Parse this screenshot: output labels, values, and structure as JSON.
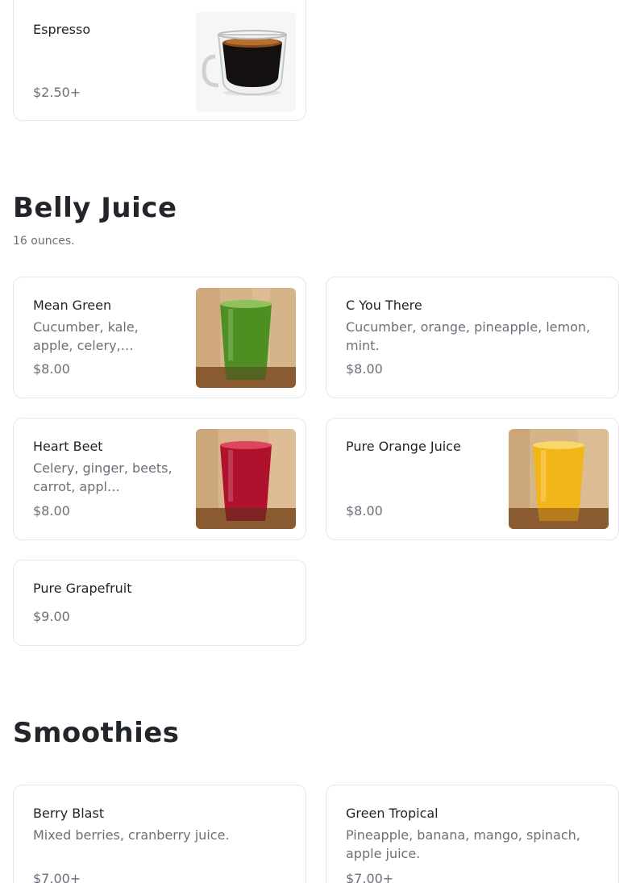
{
  "coffee": {
    "items": [
      {
        "name": "Espresso",
        "price": "$2.50+",
        "image": "espresso-cup-photo"
      }
    ]
  },
  "belly_juice": {
    "title": "Belly Juice",
    "subtitle": "16 ounces.",
    "items": [
      {
        "name": "Mean Green",
        "description": "Cucumber, kale, apple, celery,…",
        "price": "$8.00",
        "image": "green-juice-photo"
      },
      {
        "name": "C You There",
        "description": "Cucumber, orange, pineapple, lemon, mint.",
        "price": "$8.00"
      },
      {
        "name": "Heart Beet",
        "description": "Celery, ginger, beets, carrot, appl…",
        "price": "$8.00",
        "image": "beet-juice-photo"
      },
      {
        "name": "Pure Orange Juice",
        "description": "",
        "price": "$8.00",
        "image": "orange-juice-photo"
      },
      {
        "name": "Pure Grapefruit",
        "price": "$9.00"
      }
    ]
  },
  "smoothies": {
    "title": "Smoothies",
    "items": [
      {
        "name": "Berry Blast",
        "description": "Mixed berries, cranberry juice.",
        "price": "$7.00+"
      },
      {
        "name": "Green Tropical",
        "description": "Pineapple, banana, mango, spinach, apple juice.",
        "price": "$7.00+"
      }
    ]
  },
  "colors": {
    "card_border": "#e4e6ea",
    "muted_text": "#6b7078",
    "heading_text": "#22262b",
    "green_juice": "#4e8f22",
    "beet_juice": "#b0122e",
    "orange_juice": "#f2b51a"
  }
}
